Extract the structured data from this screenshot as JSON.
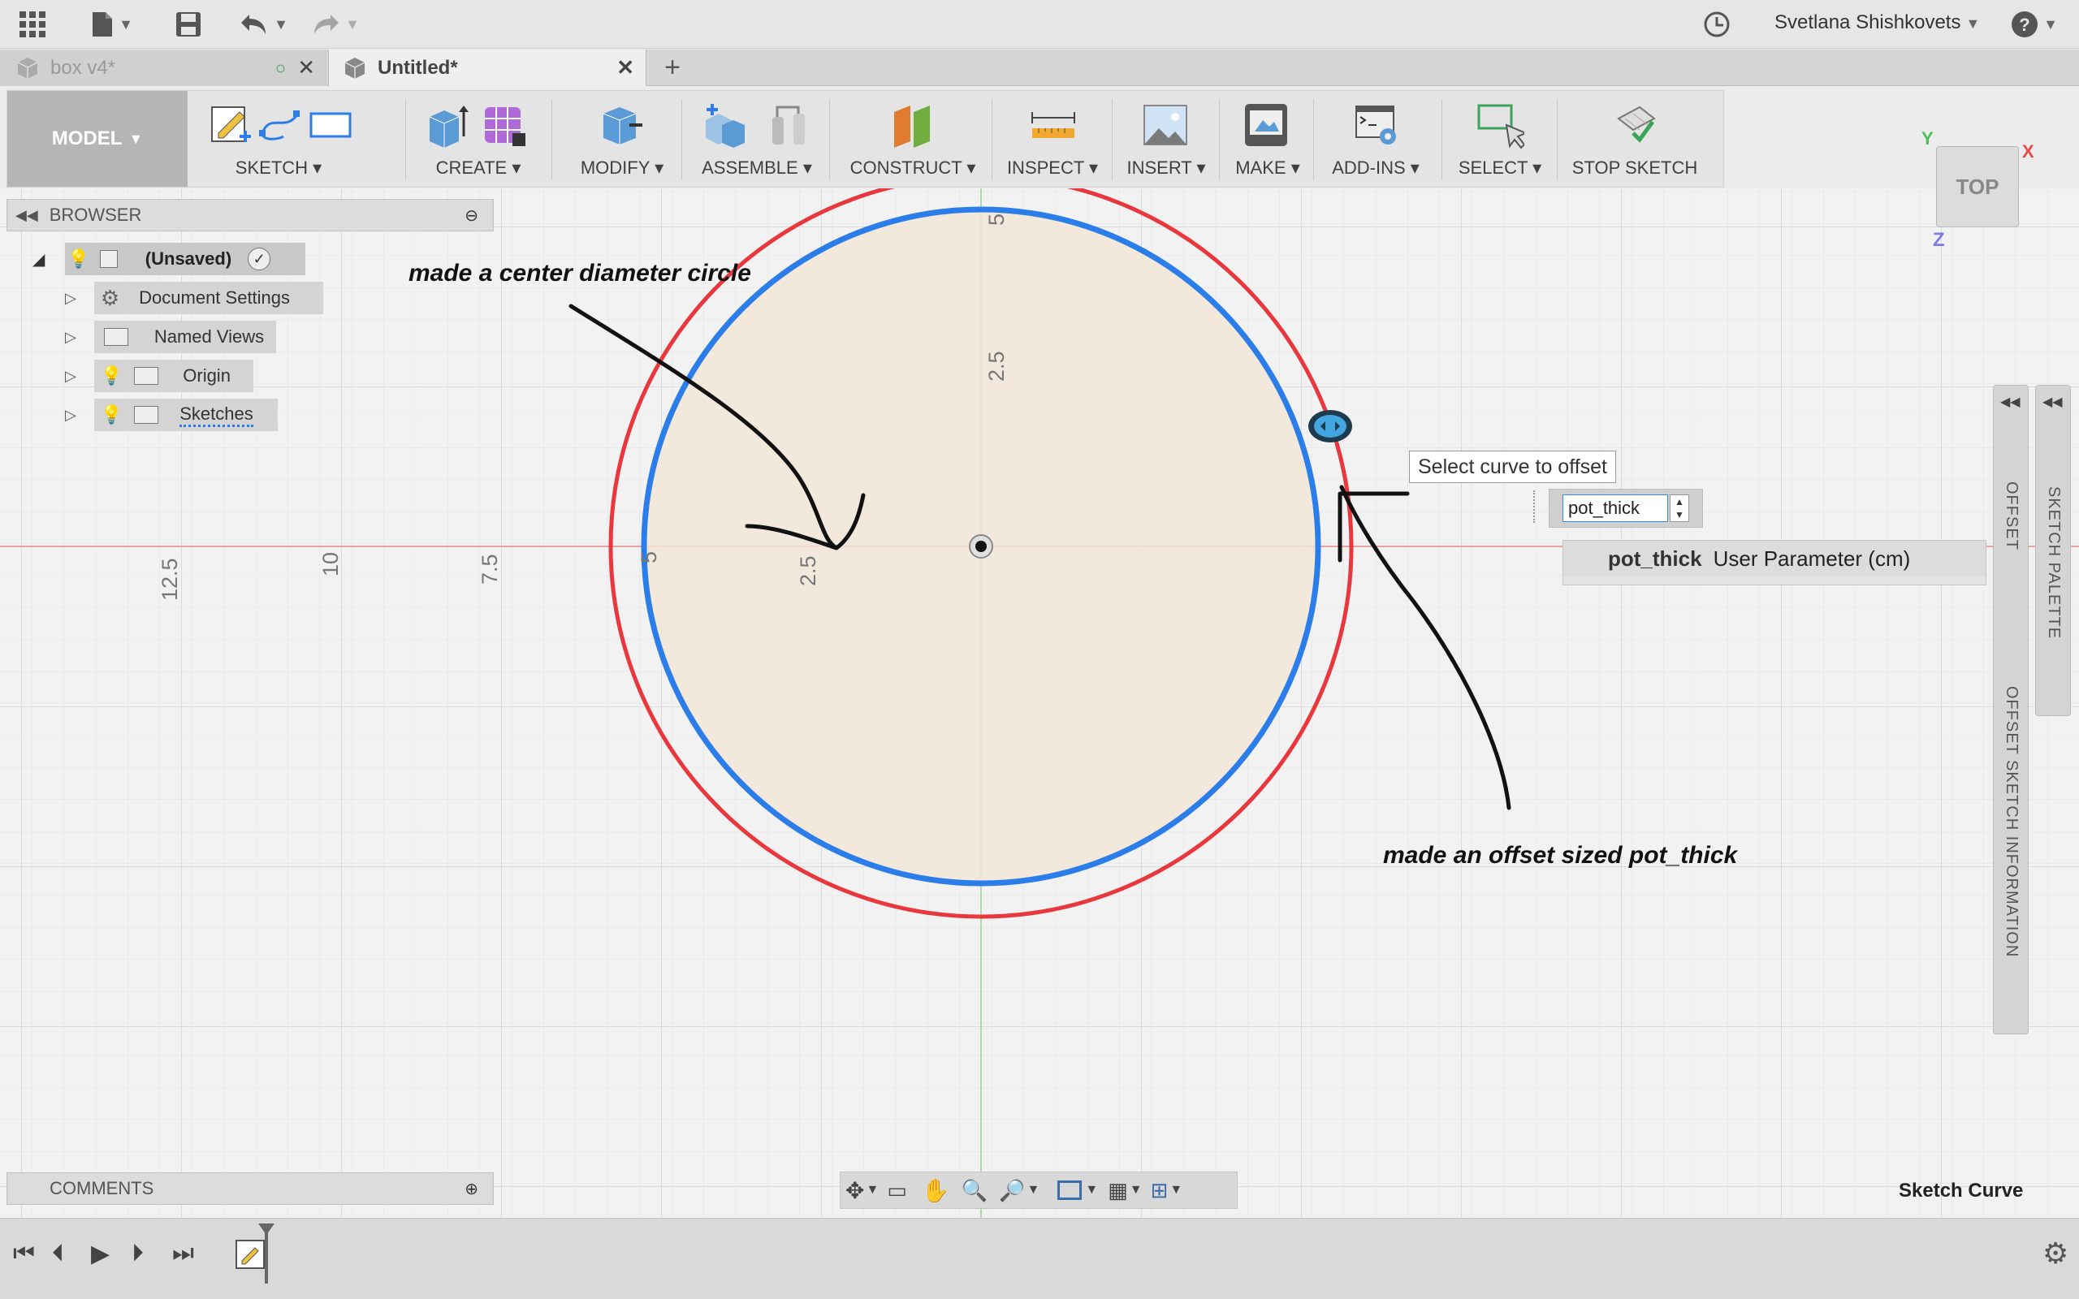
{
  "user": {
    "name": "Svetlana Shishkovets"
  },
  "tabs": [
    {
      "label": "box v4*",
      "active": false
    },
    {
      "label": "Untitled*",
      "active": true
    }
  ],
  "toolbar": {
    "workspace": "MODEL",
    "groups": [
      {
        "label": "SKETCH"
      },
      {
        "label": "CREATE"
      },
      {
        "label": "MODIFY"
      },
      {
        "label": "ASSEMBLE"
      },
      {
        "label": "CONSTRUCT"
      },
      {
        "label": "INSPECT"
      },
      {
        "label": "INSERT"
      },
      {
        "label": "MAKE"
      },
      {
        "label": "ADD-INS"
      },
      {
        "label": "SELECT"
      },
      {
        "label": "STOP SKETCH"
      }
    ]
  },
  "browser": {
    "title": "BROWSER",
    "root": "(Unsaved)",
    "items": [
      {
        "label": "Document Settings"
      },
      {
        "label": "Named Views"
      },
      {
        "label": "Origin"
      },
      {
        "label": "Sketches"
      }
    ]
  },
  "comments": {
    "title": "COMMENTS"
  },
  "canvas": {
    "axis_labels_h": [
      "12.5",
      "10",
      "7.5",
      "5",
      "2.5"
    ],
    "axis_labels_v": [
      "5",
      "2.5"
    ],
    "annotation_left": "made a center diameter circle",
    "annotation_right": "made an offset sized pot_thick",
    "tooltip": "Select curve to offset",
    "input_value": "pot_thick",
    "autocomplete": {
      "name": "pot_thick",
      "desc": "User Parameter (cm)"
    },
    "viewcube": {
      "face": "TOP",
      "axis_y": "Y",
      "axis_x": "X",
      "axis_z": "Z"
    }
  },
  "panels": {
    "offset": "OFFSET",
    "offset_info": "OFFSET SKETCH INFORMATION",
    "palette": "SKETCH PALETTE"
  },
  "status": {
    "selection": "Sketch Curve"
  },
  "colors": {
    "sketch_blue": "#2b7de9",
    "offset_red": "#e8383d",
    "fill_tan": "#f3e6d8"
  }
}
